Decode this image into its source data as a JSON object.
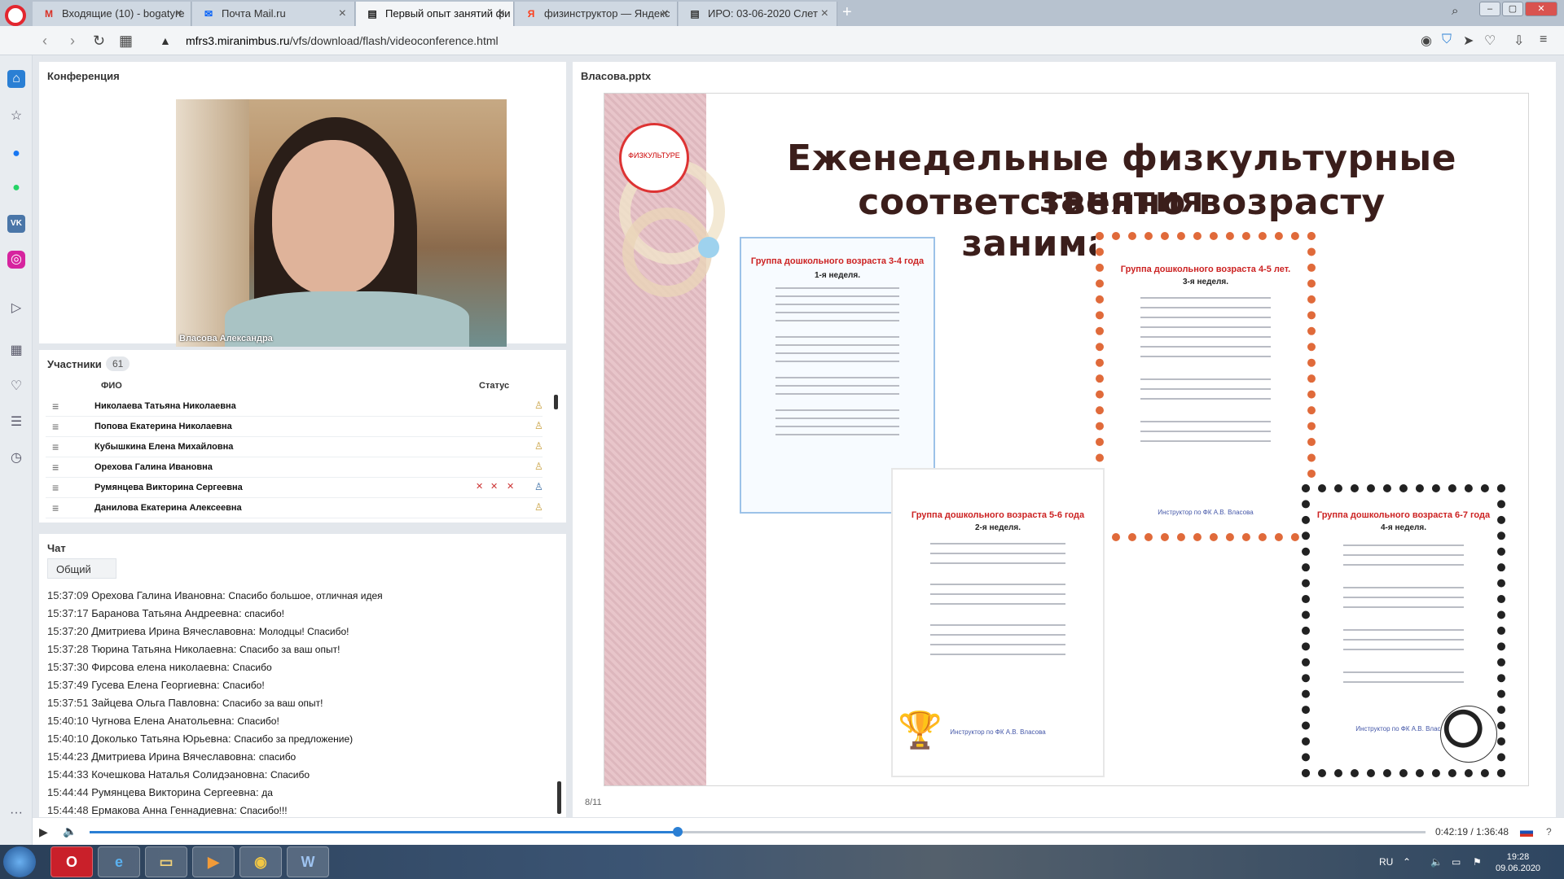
{
  "browser": {
    "tabs": [
      {
        "label": "Входящие (10) - bogatyre",
        "icon": "gmail-icon",
        "icon_glyph": "M",
        "icon_color": "#d93025",
        "active": false
      },
      {
        "label": "Почта Mail.ru",
        "icon": "mail-ru-icon",
        "icon_glyph": "✉",
        "icon_color": "#005ff9",
        "active": false
      },
      {
        "label": "Первый опыт занятий фи",
        "icon": "document-icon",
        "icon_glyph": "▤",
        "icon_color": "#555555",
        "active": true
      },
      {
        "label": "физинструктор — Яндекс",
        "icon": "yandex-icon",
        "icon_glyph": "Я",
        "icon_color": "#fc3f1d",
        "active": false
      },
      {
        "label": "ИРО: 03-06-2020 Слет",
        "icon": "document-icon",
        "icon_glyph": "▤",
        "icon_color": "#555555",
        "active": false
      }
    ],
    "url_host": "mfrs3.miranimbus.ru",
    "url_path": "/vfs/download/flash/videoconference.html"
  },
  "conference": {
    "title": "Конференция",
    "speaker_name": "Власова  Александра"
  },
  "participants": {
    "title": "Участники",
    "count": "61",
    "col_name": "ФИО",
    "col_status": "Статус",
    "rows": [
      {
        "name": "Николаева Татьяна  Николаевна",
        "muted": false
      },
      {
        "name": "Попова  Екатерина Николаевна",
        "muted": false
      },
      {
        "name": "Кубышкина Елена  Михайловна",
        "muted": false
      },
      {
        "name": "Орехова  Галина  Ивановна",
        "muted": false
      },
      {
        "name": "Румянцева Викторина  Сергеевна",
        "muted": true
      },
      {
        "name": "Данилова  Екатерина  Алексеевна",
        "muted": false
      }
    ]
  },
  "chat": {
    "title": "Чат",
    "tab": "Общий",
    "messages": [
      {
        "time": "15:37:09",
        "author": "Орехова  Галина  Ивановна:",
        "text": "Спасибо большое,  отличная идея"
      },
      {
        "time": "15:37:17",
        "author": "Баранова Татьяна  Андреевна:",
        "text": "спасибо!"
      },
      {
        "time": "15:37:20",
        "author": "Дмитриева  Ирина  Вячеславовна:",
        "text": "Молодцы! Спасибо!"
      },
      {
        "time": "15:37:28",
        "author": "Тюрина  Татьяна  Николаевна:",
        "text": "Спасибо за ваш опыт!"
      },
      {
        "time": "15:37:30",
        "author": "Фирсова  елена николаевна:",
        "text": "Спасибо"
      },
      {
        "time": "15:37:49",
        "author": "Гусева Елена  Георгиевна:",
        "text": "Спасибо!"
      },
      {
        "time": "15:37:51",
        "author": "Зайцева Ольга  Павловна:",
        "text": "Спасибо за ваш опыт!"
      },
      {
        "time": "15:40:10",
        "author": "Чугнова  Елена   Анатольевна:",
        "text": "Спасибо!"
      },
      {
        "time": "15:40:10",
        "author": "Доколько  Татьяна   Юрьевна:",
        "text": "Спасибо за предложение)"
      },
      {
        "time": "15:44:23",
        "author": "Дмитриева  Ирина  Вячеславовна:",
        "text": "спасибо"
      },
      {
        "time": "15:44:33",
        "author": "Кочешкова  Наталья Солидэановна:",
        "text": "Спасибо"
      },
      {
        "time": "15:44:44",
        "author": "Румянцева Викторина  Сергеевна:",
        "text": "да"
      },
      {
        "time": "15:44:48",
        "author": "Ермакова  Анна  Геннадиевна:",
        "text": "Спасибо!!!"
      }
    ]
  },
  "presentation": {
    "file": "Власова.pptx",
    "title_line1": "Еженедельные физкультурные занятия",
    "title_line2": "соответственно возрасту занимающихся",
    "logo_text": "ФИЗКУЛЬТУРЕ",
    "page": "8/11",
    "docs": [
      {
        "title": "Группа дошкольного возраста 3-4 года",
        "sub": "1-я неделя."
      },
      {
        "title": "Группа дошкольного возраста 4-5 лет.",
        "sub": "3-я неделя."
      },
      {
        "title": "Группа дошкольного возраста 5-6 года",
        "sub": "2-я неделя."
      },
      {
        "title": "Группа дошкольного возраста 6-7 года",
        "sub": "4-я неделя."
      }
    ],
    "doc_footer": "Инструктор по ФК А.В. Власова"
  },
  "player": {
    "progress": 0.44,
    "time": "0:42:19 / 1:36:48",
    "help": "?"
  },
  "taskbar": {
    "lang": "RU",
    "time": "19:28",
    "date": "09.06.2020"
  }
}
